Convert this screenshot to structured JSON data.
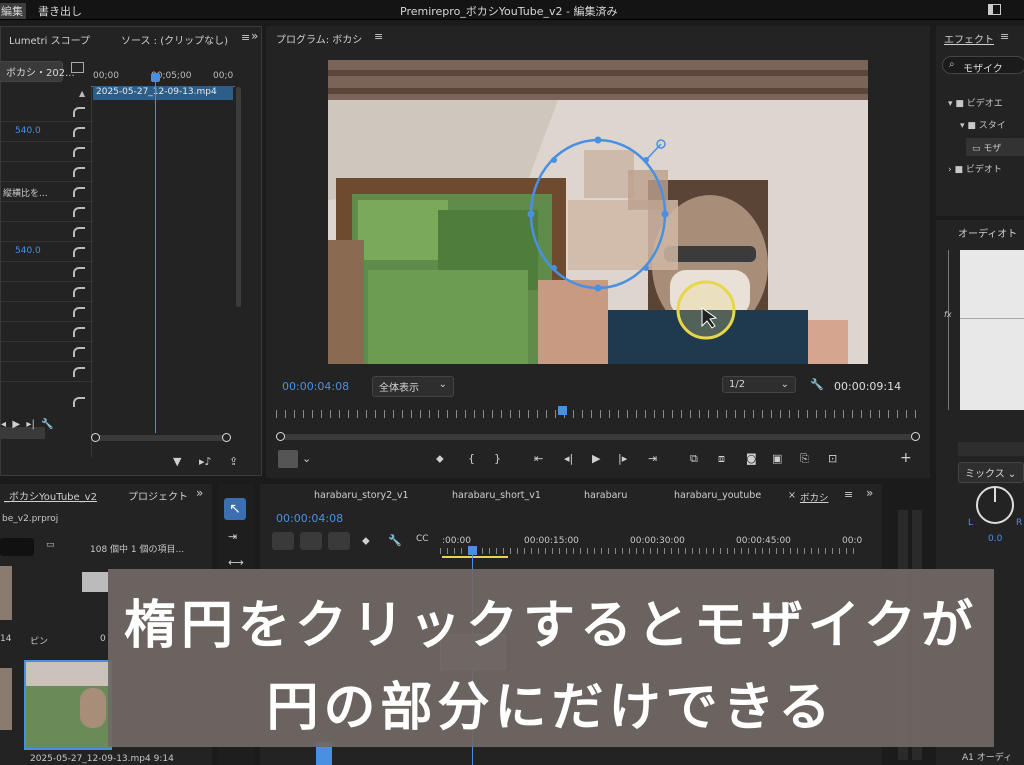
{
  "titlebar": {
    "menu_left": "編集",
    "menu_export": "書き出し",
    "title": "Premirepro_ボカシYouTube_v2 - 編集済み"
  },
  "effect_controls": {
    "tab_lumetri": "Lumetri スコープ",
    "tab_source": "ソース : (クリップなし)",
    "clip_select": "ボカシ・202...",
    "time_start": "00;00",
    "time_mid": "00;05;00",
    "time_end": "00;0",
    "clip_name": "2025-05-27_12-09-13.mp4",
    "value_1": "540.0",
    "value_2": "縦横比を...",
    "value_3": "540.0"
  },
  "program": {
    "title": "プログラム: ボカシ",
    "timecode": "00:00:04:08",
    "fit": "全体表示",
    "resolution": "1/2",
    "duration": "00:00:09:14"
  },
  "effects_panel": {
    "title": "エフェクト",
    "search": "モザイク",
    "tree": [
      "ビデオエ",
      "スタイ",
      "モザ",
      "ビデオト"
    ]
  },
  "audio_panel": {
    "title": "オーディオト",
    "mix": "ミックス",
    "value": "0.0",
    "track": "A1",
    "track_label": "オーディ"
  },
  "project_panel": {
    "tab_project": "_ボカシYouTube_v2",
    "tab_project2": "プロジェクト",
    "file": "be_v2.prproj",
    "count": "108 個中 1 個の項目...",
    "thumb1_label": "14",
    "pin_label": "ピン",
    "clip_label": "2025-05-27_12-09-13.mp4",
    "clip_duration": "9:14",
    "side_label": "0"
  },
  "timeline": {
    "tabs": [
      "harabaru_story2_v1",
      "harabaru_short_v1",
      "harabaru",
      "harabaru_youtube",
      "ボカシ"
    ],
    "timecode": "00:00:04:08",
    "ruler": [
      ":00:00",
      "00:00:15:00",
      "00:00:30:00",
      "00:00:45:00",
      "00:0"
    ]
  },
  "caption": {
    "line1": "楕円をクリックするとモザイクが",
    "line2": "円の部分にだけできる"
  },
  "colors": {
    "accent": "#4a90e2",
    "caption_bg": "#706864",
    "ellipse": "#4a90e2",
    "cursor_ring": "#e8d64a"
  }
}
